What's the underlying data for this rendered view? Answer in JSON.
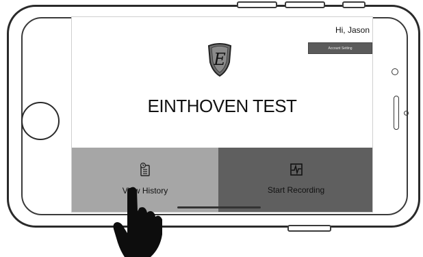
{
  "header": {
    "greeting": "Hi, Jason",
    "account_setting_label": "Account Setting"
  },
  "main": {
    "title": "EINTHOVEN TEST",
    "logo_letter": "E"
  },
  "tiles": [
    {
      "label": "View History",
      "icon": "history-clipboard-icon"
    },
    {
      "label": "Start Recording",
      "icon": "ecg-recording-icon"
    }
  ],
  "colors": {
    "tile_left": "#a6a6a6",
    "tile_right": "#5f5f5f",
    "account_button": "#5b5b5b"
  }
}
